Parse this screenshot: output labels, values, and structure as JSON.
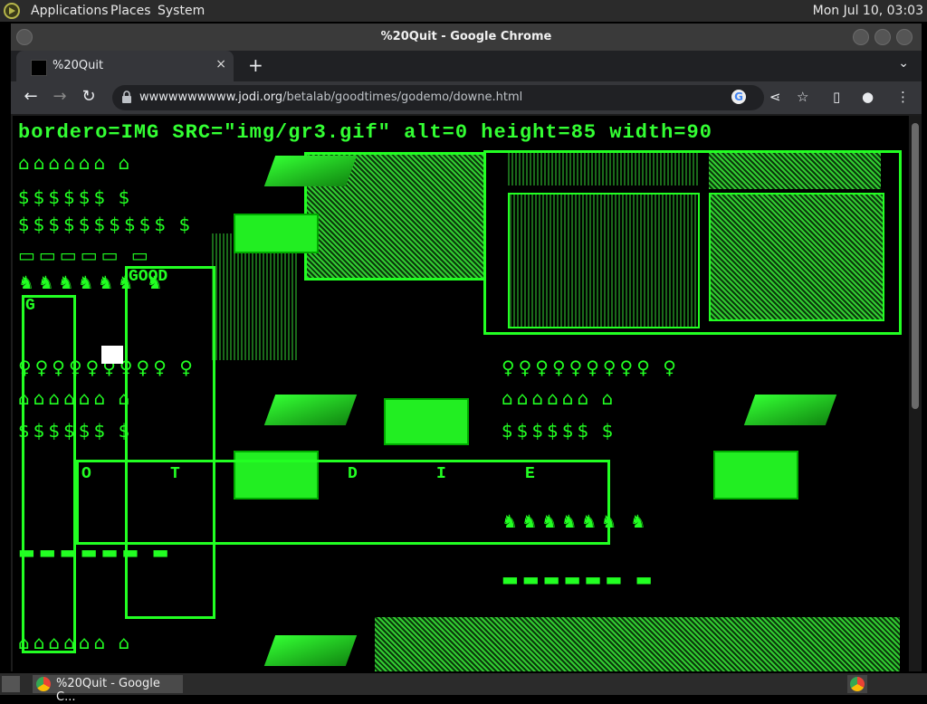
{
  "desktop": {
    "menu": [
      "Applications",
      "Places",
      "System"
    ],
    "clock": "Mon Jul 10, 03:03"
  },
  "window": {
    "title": "%20Quit - Google Chrome"
  },
  "tab": {
    "title": "%20Quit",
    "close": "×"
  },
  "toolbar": {
    "url_host": "wwwwwwwwww.jodi.org",
    "url_path": "/betalab/goodtimes/godemo/downe.html"
  },
  "page": {
    "code_text": "bordero=IMG SRC=\"img/gr3.gif\" alt=0 height=85  width=90",
    "broken_labels": [
      "GOOD",
      "G",
      "O",
      "T",
      "D",
      "I",
      "E"
    ],
    "icon_rows": {
      "houses": "⌂⌂⌂⌂⌂⌂  ⌂",
      "moneybags": "$$$$$$  $",
      "dollars": "$$$$$$$$$$ $",
      "tvs": "▭▭▭▭▭  ▭",
      "horses": "♞♞♞♞♞♞  ♞",
      "people": "♀♀♀♀♀♀♀♀♀  ♀",
      "cars": "▬▬▬▬▬▬  ▬"
    },
    "accent_color": "#22ff22"
  },
  "taskbar": {
    "task_label": "%20Quit - Google C..."
  }
}
